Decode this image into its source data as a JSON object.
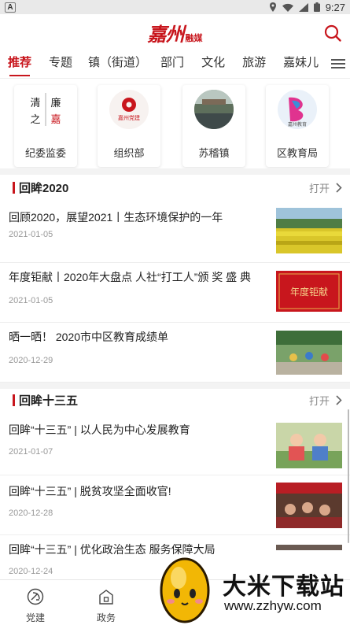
{
  "status_bar": {
    "time": "9:27",
    "badge": "A"
  },
  "header": {
    "logo_main": "嘉州",
    "logo_sub": "融媒"
  },
  "tabs": [
    {
      "label": "推荐"
    },
    {
      "label": "专题"
    },
    {
      "label": "镇（街道）"
    },
    {
      "label": "部门"
    },
    {
      "label": "文化"
    },
    {
      "label": "旅游"
    },
    {
      "label": "嘉妹儿"
    }
  ],
  "channels": [
    {
      "label": "纪委监委",
      "thumb_text": [
        "清",
        "廉",
        "之",
        "嘉"
      ]
    },
    {
      "label": "组织部",
      "thumb_text": [
        "嘉州党建"
      ]
    },
    {
      "label": "苏稽镇"
    },
    {
      "label": "区教育局",
      "thumb_text": [
        "嘉州教育"
      ]
    }
  ],
  "sections": [
    {
      "title": "回眸2020",
      "open_label": "打开",
      "items": [
        {
          "headline": "回顾2020，展望2021丨生态环境保护的一年",
          "date": "2021-01-05"
        },
        {
          "headline": "年度钜献丨2020年大盘点 人社“打工人”颁 奖 盛 典",
          "date": "2021-01-05",
          "pic_text": "年度钜献"
        },
        {
          "headline": "晒一晒！ 2020市中区教育成绩单",
          "date": "2020-12-29"
        }
      ]
    },
    {
      "title": "回眸十三五",
      "open_label": "打开",
      "items": [
        {
          "headline": "回眸“十三五” | 以人民为中心发展教育",
          "date": "2021-01-07"
        },
        {
          "headline": "回眸“十三五” | 脱贫攻坚全面收官!",
          "date": "2020-12-28"
        },
        {
          "headline": "回眸“十三五” | 优化政治生态 服务保障大局",
          "date": "2020-12-24"
        }
      ]
    }
  ],
  "bottom_nav": [
    {
      "label": "党建",
      "icon": "party-emblem-icon"
    },
    {
      "label": "政务",
      "icon": "building-icon"
    }
  ],
  "watermark": {
    "name": "大米下载站",
    "url": "www.zzhyw.com"
  },
  "colors": {
    "accent": "#c8161d",
    "divider": "#f3f3f3"
  }
}
